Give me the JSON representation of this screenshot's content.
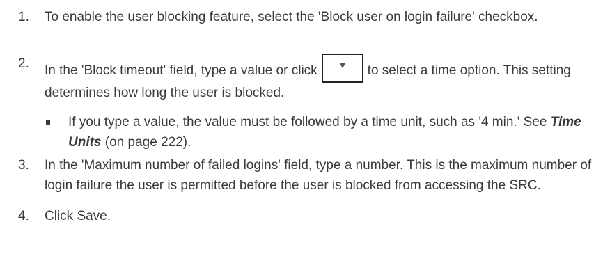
{
  "steps": [
    {
      "number": "1.",
      "text": "To enable the user blocking feature, select the 'Block user on login failure' checkbox."
    },
    {
      "number": "2.",
      "text_before": "In the 'Block timeout' field, type a value or click",
      "text_after": "to select a time option. This setting determines how long the user is blocked.",
      "icon": "dropdown-arrow-icon",
      "bullet": {
        "text_before": "If you type a value, the value must be followed by a time unit, such as '4 min.' See",
        "link_text": "Time Units",
        "text_after": "(on page 222)."
      }
    },
    {
      "number": "3.",
      "text": "In the 'Maximum number of failed logins' field, type a number. This is the maximum number of login failure the user is permitted before the user is blocked from accessing the SRC."
    },
    {
      "number": "4.",
      "text": "Click Save."
    }
  ]
}
